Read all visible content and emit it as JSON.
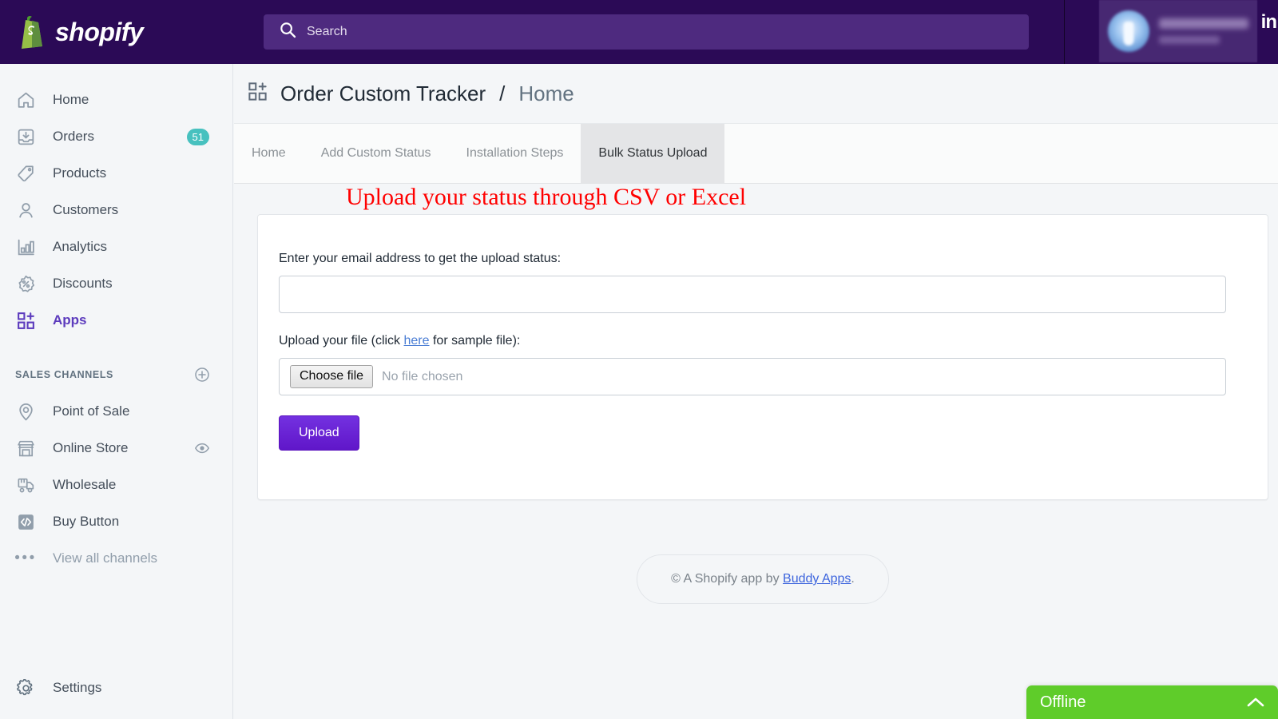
{
  "topbar": {
    "brand_name": "shopify",
    "brand_icon": "shopify-bag-icon",
    "search_placeholder": "Search",
    "search_icon": "search-icon",
    "user_name_redacted": "",
    "user_tail_text": "in",
    "bar_color": "#2b0a56",
    "search_field_color": "#4e2a7f"
  },
  "sidebar": {
    "items": [
      {
        "label": "Home",
        "icon": "home-icon",
        "badge": "",
        "active": false
      },
      {
        "label": "Orders",
        "icon": "orders-inbox-icon",
        "badge": "51",
        "active": false
      },
      {
        "label": "Products",
        "icon": "tag-icon",
        "badge": "",
        "active": false
      },
      {
        "label": "Customers",
        "icon": "person-icon",
        "badge": "",
        "active": false
      },
      {
        "label": "Analytics",
        "icon": "bar-chart-icon",
        "badge": "",
        "active": false
      },
      {
        "label": "Discounts",
        "icon": "percent-badge-icon",
        "badge": "",
        "active": false
      },
      {
        "label": "Apps",
        "icon": "apps-grid-plus-icon",
        "badge": "",
        "active": true
      }
    ],
    "sales_channels": {
      "heading": "SALES CHANNELS",
      "add_icon": "plus-circle-icon",
      "items": [
        {
          "label": "Point of Sale",
          "icon": "location-pin-icon",
          "trailing_icon": ""
        },
        {
          "label": "Online Store",
          "icon": "storefront-icon",
          "trailing_icon": "eye-icon"
        },
        {
          "label": "Wholesale",
          "icon": "wholesale-truck-icon",
          "trailing_icon": ""
        },
        {
          "label": "Buy Button",
          "icon": "code-brackets-icon",
          "trailing_icon": ""
        },
        {
          "label": "View all channels",
          "icon": "ellipsis-icon",
          "trailing_icon": ""
        }
      ]
    },
    "settings": {
      "label": "Settings",
      "icon": "gear-icon"
    },
    "badge_color": "#47c1bf",
    "active_color": "#5c3bbd"
  },
  "app_header": {
    "icon": "apps-grid-plus-icon",
    "title": "Order Custom Tracker",
    "separator": "/",
    "crumb": "Home"
  },
  "tabs": [
    {
      "label": "Home",
      "active": false
    },
    {
      "label": "Add Custom Status",
      "active": false
    },
    {
      "label": "Installation Steps",
      "active": false
    },
    {
      "label": "Bulk Status Upload",
      "active": true
    }
  ],
  "main": {
    "heading": "Upload your status through CSV or Excel",
    "heading_color": "#ff0000",
    "email_label": "Enter your email address to get the upload status:",
    "email_value": "",
    "email_placeholder": "",
    "file_label_pre": "Upload your file (click ",
    "file_label_link": "here",
    "file_label_post": " for sample file):",
    "choose_file_label": "Choose file",
    "no_file_text": "No file chosen",
    "upload_button_label": "Upload",
    "upload_button_color": "#6c2bd9"
  },
  "footer": {
    "copyright_symbol": "©",
    "text_pre": " A Shopify app by ",
    "link_text": "Buddy Apps",
    "text_post": "."
  },
  "chat_widget": {
    "status_label": "Offline",
    "chevron": "⌃",
    "color": "#5fcc2a"
  }
}
